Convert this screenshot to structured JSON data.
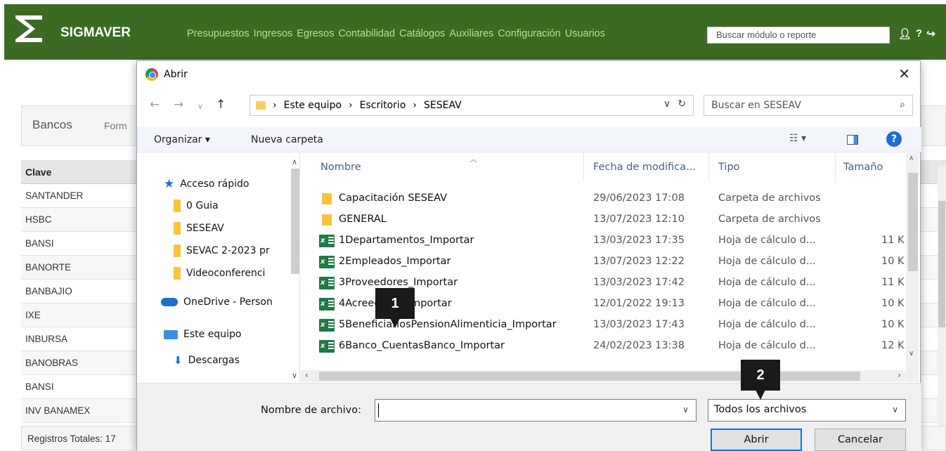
{
  "app": {
    "logo_text": "SIGMAVER",
    "menu": [
      "Presupuestos",
      "Ingresos",
      "Egresos",
      "Contabilidad",
      "Catálogos",
      "Auxiliares",
      "Configuración",
      "Usuarios"
    ],
    "search_placeholder": "Buscar módulo o reporte",
    "panel_title": "Bancos",
    "panel_tab": "Form",
    "table_header": "Clave",
    "table_rows": [
      "SANTANDER",
      "HSBC",
      "BANSI",
      "BANORTE",
      "BANBAJIO",
      "IXE",
      "INBURSA",
      "BANOBRAS",
      "BANSI",
      "INV BANAMEX"
    ],
    "footer": "Registros Totales: 17",
    "green": "#3b6b22"
  },
  "dialog": {
    "title": "Abrir",
    "close": "✕",
    "breadcrumb": [
      "Este equipo",
      "Escritorio",
      "SESEAV"
    ],
    "search_placeholder": "Buscar en SESEAV",
    "toolbar": {
      "organize": "Organizar ▾",
      "new_folder": "Nueva carpeta"
    },
    "nav_tree": [
      "Acceso rápido",
      "0 Guia",
      "SESEAV",
      "SEVAC 2-2023 pr",
      "Videoconferenci",
      "OneDrive - Person",
      "Este equipo",
      "Descargas"
    ],
    "columns": {
      "name": "Nombre",
      "date": "Fecha de modifica...",
      "type": "Tipo",
      "size": "Tamaño"
    },
    "files": [
      {
        "name": "Capacitación SESEAV",
        "date": "29/06/2023 17:08",
        "type": "Carpeta de archivos",
        "size": "",
        "kind": "folder"
      },
      {
        "name": "GENERAL",
        "date": "13/07/2023 12:10",
        "type": "Carpeta de archivos",
        "size": "",
        "kind": "folder"
      },
      {
        "name": "1Departamentos_Importar",
        "date": "13/03/2023 17:35",
        "type": "Hoja de cálculo d...",
        "size": "11 K",
        "kind": "excel"
      },
      {
        "name": "2Empleados_Importar",
        "date": "13/07/2023 12:22",
        "type": "Hoja de cálculo d...",
        "size": "10 K",
        "kind": "excel"
      },
      {
        "name": "3Proveedores_Importar",
        "date": "13/03/2023 17:42",
        "type": "Hoja de cálculo d...",
        "size": "11 K",
        "kind": "excel"
      },
      {
        "name": "4Acreedores_Importar",
        "date": "12/01/2022 19:13",
        "type": "Hoja de cálculo d...",
        "size": "10 K",
        "kind": "excel"
      },
      {
        "name": "5BeneficiariosPensionAlimenticia_Importar",
        "date": "13/03/2023 17:43",
        "type": "Hoja de cálculo d...",
        "size": "10 K",
        "kind": "excel"
      },
      {
        "name": "6Banco_CuentasBanco_Importar",
        "date": "24/02/2023 13:38",
        "type": "Hoja de cálculo d...",
        "size": "12 K",
        "kind": "excel"
      }
    ],
    "filename_label": "Nombre de archivo:",
    "filename_value": "",
    "filter": "Todos los archivos",
    "open_button": "Abrir",
    "cancel_button": "Cancelar"
  },
  "markers": [
    "1",
    "2"
  ]
}
